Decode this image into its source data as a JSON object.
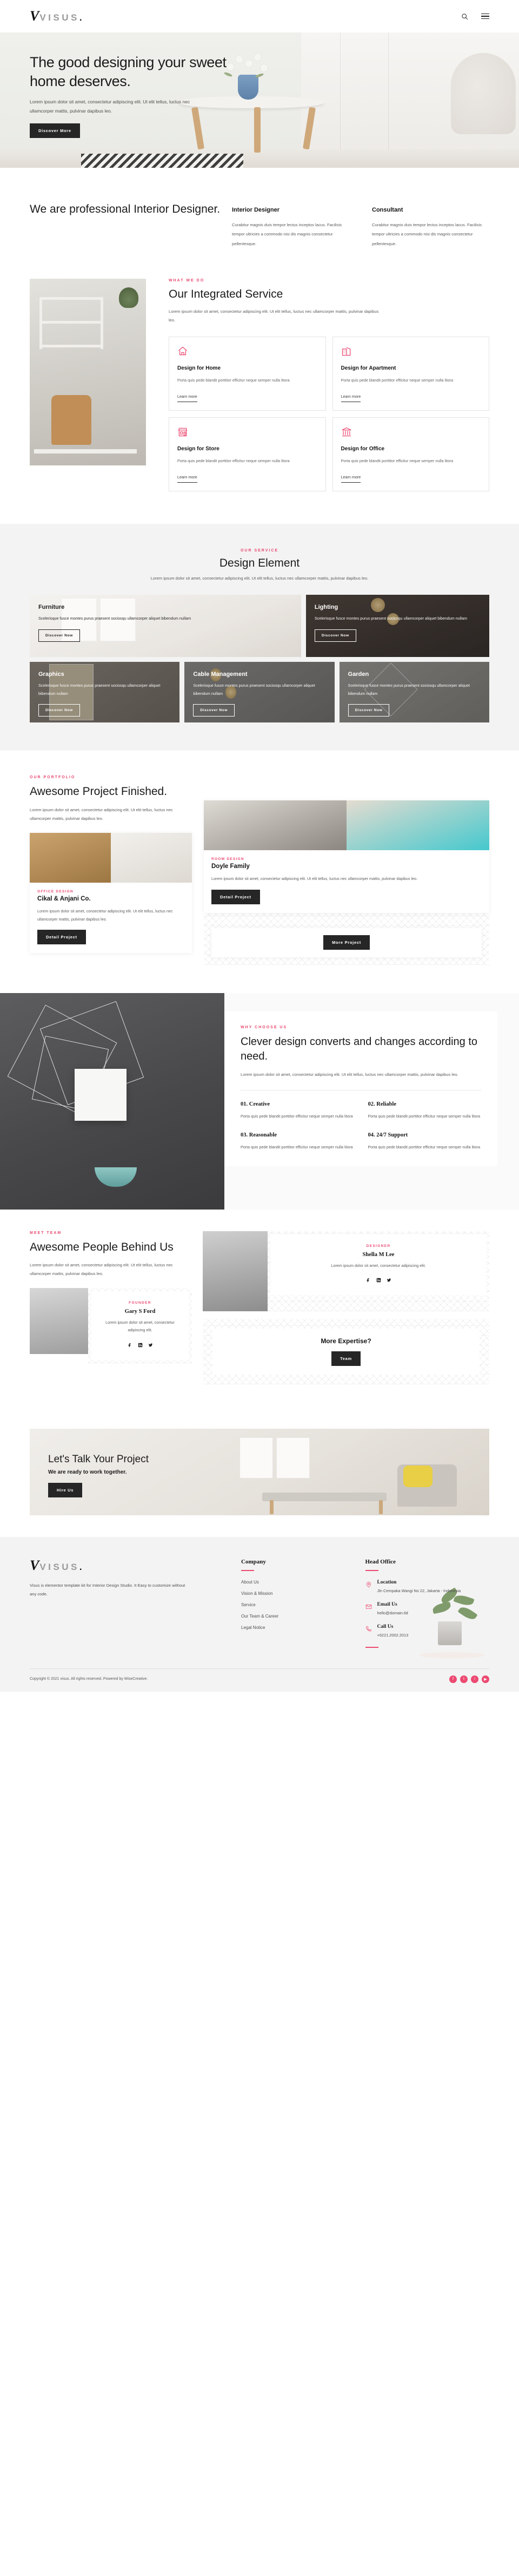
{
  "header": {
    "logo_mark": "V",
    "logo_text": "VISUS",
    "logo_period": ".",
    "search_icon": "search-icon",
    "menu_icon": "hamburger-menu-icon"
  },
  "hero": {
    "title": "The good designing your sweet home deserves.",
    "paragraph": "Lorem ipsum dolor sit amet, consectetur adipiscing elit. Ut elit tellus, luctus nec ullamcorper mattis, pulvinar dapibus leo.",
    "cta": "Discover More"
  },
  "professional": {
    "heading": "We are professional Interior Designer.",
    "columns": [
      {
        "title": "Interior Designer",
        "text": "Curabitur magnis duis tempor lectus inceptos lacus. Facilisis tempor ultricies a commodo nisi dis magnis consectetur pellentesque."
      },
      {
        "title": "Consultant",
        "text": "Curabitur magnis duis tempor lectus inceptos lacus. Facilisis tempor ultricies a commodo nisi dis magnis consectetur pellentesque."
      }
    ]
  },
  "service": {
    "eyebrow": "WHAT WE DO",
    "title": "Our Integrated Service",
    "lead": "Lorem ipsum dolor sit amet, consectetur adipiscing elit. Ut elit tellus, luctus nec ullamcorper mattis, pulvinar dapibus leo.",
    "cards": [
      {
        "icon": "home-icon",
        "title": "Design for Home",
        "text": "Porta quis pede blandit porttitor efficitur neque semper nulla litora",
        "link": "Learn more"
      },
      {
        "icon": "apartment-building-icon",
        "title": "Design for Apartment",
        "text": "Porta quis pede blandit porttitor efficitur neque semper nulla litora",
        "link": "Learn more"
      },
      {
        "icon": "store-icon",
        "title": "Design for Store",
        "text": "Porta quis pede blandit porttitor efficitur neque semper nulla litora",
        "link": "Learn more"
      },
      {
        "icon": "bank-office-icon",
        "title": "Design for Office",
        "text": "Porta quis pede blandit porttitor efficitur neque semper nulla litora",
        "link": "Learn more"
      }
    ]
  },
  "element": {
    "eyebrow": "OUR SERVICE",
    "title": "Design Element",
    "lead": "Lorem ipsum dolor sit amet, consectetur adipiscing elit. Ut elit tellus, luctus nec ullamcorper mattis, pulvinar dapibus leo.",
    "cards": [
      {
        "title": "Furniture",
        "text": "Scelerisque fusce montes purus praesent sociosqu ullamcorper aliquet bibendum nullam",
        "cta": "Discover Now"
      },
      {
        "title": "Lighting",
        "text": "Scelerisque fusce montes purus praesent sociosqu ullamcorper aliquet bibendum nullam",
        "cta": "Discover Now"
      },
      {
        "title": "Graphics",
        "text": "Scelerisque fusce montes purus praesent sociosqu ullamcorper aliquet bibendum nullam",
        "cta": "Discover Now"
      },
      {
        "title": "Cable Management",
        "text": "Scelerisque fusce montes purus praesent sociosqu ullamcorper aliquet bibendum nullam",
        "cta": "Discover Now"
      },
      {
        "title": "Garden",
        "text": "Scelerisque fusce montes purus praesent sociosqu ullamcorper aliquet bibendum nullam",
        "cta": "Discover Now"
      }
    ]
  },
  "portfolio": {
    "eyebrow": "OUR PORTFOLIO",
    "title": "Awesome Project Finished.",
    "lead": "Lorem ipsum dolor sit amet, consectetur adipiscing elit. Ut elit tellus, luctus nec ullamcorper mattis, pulvinar dapibus leo.",
    "projects": [
      {
        "tag": "OFFICE DESIGN",
        "title": "Cikal & Anjani Co.",
        "text": "Lorem ipsum dolor sit amet, consectetur adipiscing elit. Ut elit tellus, luctus nec ullamcorper mattis, pulvinar dapibus leo.",
        "cta": "Detail Project"
      },
      {
        "tag": "ROOM DESIGN",
        "title": "Doyle Family",
        "text": "Lorem ipsum dolor sit amet, consectetur adipiscing elit. Ut elit tellus, luctus nec ullamcorper mattis, pulvinar dapibus leo.",
        "cta": "Detail Project"
      }
    ],
    "more_cta": "More Project"
  },
  "why": {
    "eyebrow": "WHY CHOOSE US",
    "title": "Clever design converts and changes according to need.",
    "lead": "Lorem ipsum dolor sit amet, consectetur adipiscing elit. Ut elit tellus, luctus nec ullamcorper mattis, pulvinar dapibus leo.",
    "items": [
      {
        "title": "01. Creative",
        "text": "Porta quis pede blandit porttitor efficitur neque semper nulla litora"
      },
      {
        "title": "02. Reliable",
        "text": "Porta quis pede blandit porttitor efficitur neque semper nulla litora"
      },
      {
        "title": "03. Reasonable",
        "text": "Porta quis pede blandit porttitor efficitur neque semper nulla litora"
      },
      {
        "title": "04. 24/7 Support",
        "text": "Porta quis pede blandit porttitor efficitur neque semper nulla litora"
      }
    ]
  },
  "team": {
    "eyebrow": "MEET TEAM",
    "title": "Awesome People Behind Us",
    "lead": "Lorem ipsum dolor sit amet, consectetur adipiscing elit. Ut elit tellus, luctus nec ullamcorper mattis, pulvinar dapibus leo.",
    "members": [
      {
        "role": "FOUNDER",
        "name": "Gary S Ford",
        "text": "Lorem ipsum dolor sit amet, consectetur adipiscing elit.",
        "socials": [
          "facebook-icon",
          "linkedin-icon",
          "twitter-icon"
        ]
      },
      {
        "role": "DESIGNER",
        "name": "Shella M Lee",
        "text": "Lorem ipsum dolor sit amet, consectetur adipiscing elit.",
        "socials": [
          "facebook-icon",
          "linkedin-icon",
          "twitter-icon"
        ]
      }
    ],
    "expertise_title": "More Expertise?",
    "expertise_cta": "Team"
  },
  "cta": {
    "title": "Let's Talk Your Project",
    "subtitle": "We are ready to work together.",
    "button": "Hire Us"
  },
  "footer": {
    "logo_mark": "V",
    "logo_text": "VISUS",
    "logo_period": ".",
    "about": "Visus is elementor template kit for Interior Design Studio. It Easy to customize without any code.",
    "company_title": "Company",
    "company_links": [
      "About Us",
      "Vision & Mission",
      "Service",
      "Our Team & Career",
      "Legal Notice"
    ],
    "office_title": "Head Office",
    "contacts": [
      {
        "icon": "map-pin-icon",
        "label": "Location",
        "value": "Jln Cempaka Wangi No 22, Jakarta - Indonesia"
      },
      {
        "icon": "envelope-icon",
        "label": "Email Us",
        "value": "hello@domain.tld"
      },
      {
        "icon": "phone-icon",
        "label": "Call Us",
        "value": "+6221.2002.2013"
      }
    ],
    "copyright": "Copyright © 2021 visus. All rights reserved. Powered by WiseCreative.",
    "socials": [
      "facebook-icon",
      "twitter-icon",
      "instagram-icon",
      "youtube-icon"
    ]
  },
  "colors": {
    "accent": "#ec4a72",
    "dark": "#262626",
    "muted": "#5a5a5a"
  }
}
